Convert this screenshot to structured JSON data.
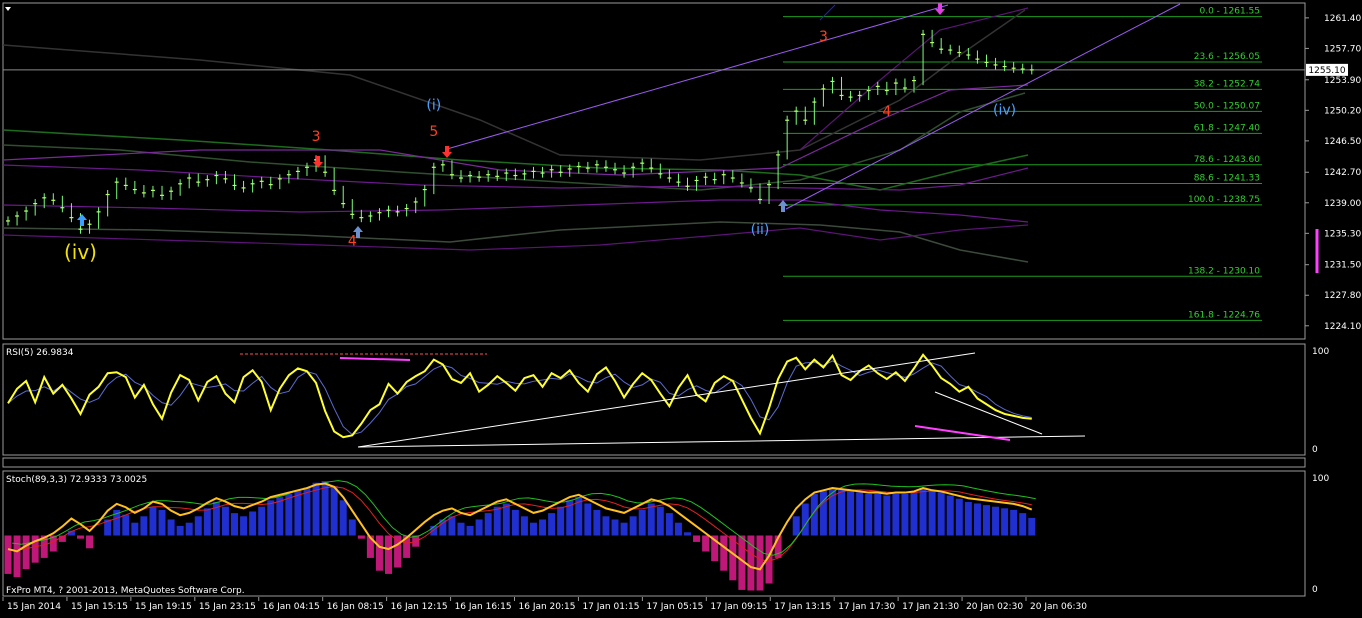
{
  "chart_data": {
    "type": "line",
    "title": "",
    "symbol_note": "",
    "copyright": "FxPro MT4, ? 2001-2013, MetaQuotes Software Corp.",
    "current_price": "1255.10",
    "price_axis": {
      "range": [
        1222.5,
        1263.2
      ],
      "ticks": [
        "1261.40",
        "1257.70",
        "1253.90",
        "1250.20",
        "1246.50",
        "1242.70",
        "1239.00",
        "1235.30",
        "1231.50",
        "1227.80",
        "1224.10"
      ]
    },
    "time_axis": {
      "labels": [
        "15 Jan 2014",
        "15 Jan 15:15",
        "15 Jan 19:15",
        "15 Jan 23:15",
        "16 Jan 04:15",
        "16 Jan 08:15",
        "16 Jan 12:15",
        "16 Jan 16:15",
        "16 Jan 20:15",
        "17 Jan 01:15",
        "17 Jan 05:15",
        "17 Jan 09:15",
        "17 Jan 13:15",
        "17 Jan 17:30",
        "17 Jan 21:30",
        "20 Jan 02:30",
        "20 Jan 06:30"
      ]
    },
    "fib_levels": [
      {
        "label": "0.0 - 1261.55",
        "value": 1261.55
      },
      {
        "label": "23.6 - 1256.05",
        "value": 1256.05
      },
      {
        "label": "38.2 - 1252.74",
        "value": 1252.74
      },
      {
        "label": "50.0 - 1250.07",
        "value": 1250.07
      },
      {
        "label": "61.8 - 1247.40",
        "value": 1247.4
      },
      {
        "label": "78.6 - 1243.60",
        "value": 1243.6
      },
      {
        "label": "88.6 - 1241.33",
        "value": 1241.33
      },
      {
        "label": "100.0 - 1238.75",
        "value": 1238.75
      },
      {
        "label": "138.2 - 1230.10",
        "value": 1230.1
      },
      {
        "label": "161.8 - 1224.76",
        "value": 1224.76
      }
    ],
    "wave_labels": [
      {
        "text": "(iv)",
        "color": "#f0e010",
        "index": 8,
        "price": 1232.2
      },
      {
        "text": "3",
        "color": "#ff4020",
        "index": 34,
        "price": 1246.5
      },
      {
        "text": "4",
        "color": "#ff4020",
        "index": 38,
        "price": 1233.8
      },
      {
        "text": "(i)",
        "color": "#4aa0ff",
        "index": 47,
        "price": 1250.3
      },
      {
        "text": "5",
        "color": "#ff4020",
        "index": 47,
        "price": 1247.1
      },
      {
        "text": "(ii)",
        "color": "#4aa0ff",
        "index": 83,
        "price": 1235.2
      },
      {
        "text": "3",
        "color": "#ff4020",
        "index": 90,
        "price": 1258.6
      },
      {
        "text": "4",
        "color": "#ff4020",
        "index": 97,
        "price": 1249.5
      },
      {
        "text": "(iv)",
        "color": "#4aa0ff",
        "index": 110,
        "price": 1249.7
      }
    ],
    "series": [
      {
        "name": "price",
        "values": [
          1236.8,
          1237.4,
          1238.0,
          1238.9,
          1239.6,
          1239.3,
          1238.4,
          1237.2,
          1235.8,
          1236.4,
          1237.9,
          1240.0,
          1241.5,
          1241.1,
          1240.6,
          1240.2,
          1240.5,
          1239.9,
          1240.4,
          1241.3,
          1242.0,
          1241.5,
          1241.8,
          1242.3,
          1241.9,
          1241.1,
          1240.8,
          1241.3,
          1241.6,
          1241.2,
          1241.9,
          1242.4,
          1242.8,
          1243.3,
          1244.2,
          1242.7,
          1240.5,
          1238.9,
          1237.6,
          1237.2,
          1237.4,
          1237.8,
          1238.1,
          1237.9,
          1238.3,
          1239.1,
          1240.6,
          1243.3,
          1243.6,
          1242.4,
          1242.0,
          1242.3,
          1242.1,
          1242.4,
          1242.2,
          1242.6,
          1242.3,
          1242.5,
          1242.8,
          1242.6,
          1243.0,
          1242.7,
          1243.1,
          1243.4,
          1243.2,
          1243.6,
          1243.3,
          1243.0,
          1242.6,
          1243.3,
          1243.8,
          1243.2,
          1242.5,
          1242.0,
          1241.5,
          1241.0,
          1241.7,
          1242.1,
          1241.8,
          1242.4,
          1242.0,
          1241.4,
          1240.8,
          1239.4,
          1241.2,
          1244.8,
          1249.0,
          1250.1,
          1249.0,
          1251.2,
          1252.8,
          1253.7,
          1252.0,
          1251.8,
          1252.0,
          1252.6,
          1253.1,
          1252.6,
          1253.5,
          1252.9,
          1253.8,
          1259.4,
          1258.4,
          1257.6,
          1257.5,
          1257.2,
          1256.9,
          1256.4,
          1256.0,
          1255.7,
          1255.5,
          1255.3,
          1255.2,
          1255.1
        ]
      },
      {
        "name": "RSI(5) 26.9834",
        "range": [
          0,
          100
        ],
        "values": [
          43,
          58,
          66,
          44,
          70,
          53,
          62,
          48,
          32,
          52,
          60,
          74,
          75,
          70,
          49,
          62,
          42,
          27,
          54,
          72,
          67,
          46,
          65,
          71,
          53,
          44,
          70,
          77,
          65,
          36,
          58,
          72,
          79,
          76,
          64,
          35,
          14,
          8,
          10,
          22,
          36,
          42,
          63,
          53,
          65,
          71,
          76,
          88,
          83,
          68,
          64,
          74,
          55,
          62,
          71,
          64,
          56,
          69,
          72,
          60,
          74,
          69,
          77,
          64,
          55,
          73,
          80,
          66,
          49,
          63,
          74,
          67,
          53,
          40,
          59,
          72,
          52,
          45,
          64,
          71,
          66,
          47,
          28,
          12,
          38,
          68,
          86,
          90,
          78,
          88,
          80,
          92,
          72,
          67,
          76,
          82,
          74,
          68,
          75,
          66,
          79,
          93,
          82,
          69,
          63,
          55,
          60,
          48,
          42,
          36,
          32,
          30,
          28,
          27
        ]
      },
      {
        "name": "Stoch(89,3,3) 72.9333 73.0025",
        "range": [
          0,
          100
        ],
        "values": [
          38,
          36,
          41,
          45,
          48,
          52,
          58,
          65,
          60,
          54,
          62,
          72,
          78,
          75,
          70,
          74,
          80,
          78,
          72,
          68,
          70,
          74,
          79,
          83,
          80,
          76,
          74,
          77,
          80,
          84,
          86,
          88,
          90,
          92,
          95,
          96,
          93,
          84,
          72,
          60,
          48,
          40,
          38,
          42,
          48,
          55,
          62,
          68,
          72,
          74,
          70,
          68,
          72,
          76,
          80,
          82,
          78,
          74,
          70,
          72,
          76,
          80,
          84,
          86,
          82,
          78,
          74,
          72,
          70,
          74,
          78,
          82,
          80,
          76,
          70,
          64,
          58,
          52,
          46,
          40,
          34,
          28,
          22,
          20,
          32,
          48,
          62,
          74,
          82,
          88,
          90,
          92,
          91,
          90,
          89,
          88,
          88,
          87,
          88,
          88,
          89,
          92,
          90,
          89,
          87,
          85,
          83,
          82,
          81,
          80,
          79,
          78,
          76,
          73
        ]
      }
    ]
  }
}
